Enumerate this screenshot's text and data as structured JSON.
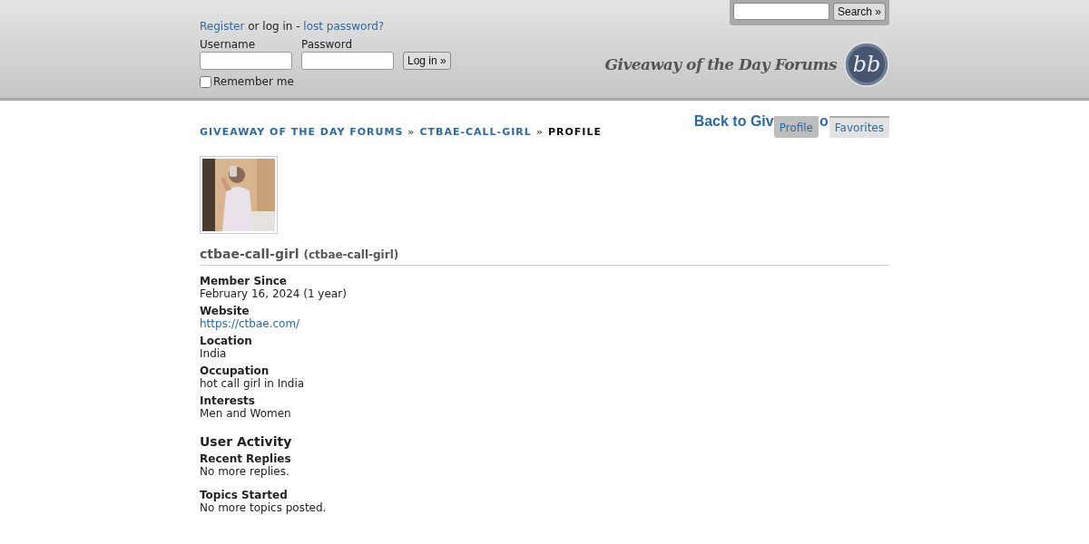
{
  "header": {
    "register_link": "Register",
    "login_text": "or log in -",
    "lost_password_link": "lost password?",
    "username_label": "Username",
    "password_label": "Password",
    "login_button": "Log in »",
    "remember_me": {
      "label": "Remember me",
      "checked": false
    },
    "search_button": "Search »",
    "site_title": "Giveaway of the Day Forums",
    "logo_mark": "bb"
  },
  "back_link": {
    "text": "Back to Giv",
    "fragment": "o"
  },
  "tabs": [
    {
      "label": "Profile",
      "selected": true
    },
    {
      "label": "Favorites",
      "selected": false
    }
  ],
  "breadcrumb": [
    {
      "label": "GIVEAWAY OF THE DAY FORUMS",
      "link": true
    },
    {
      "label": "CTBAE-CALL-GIRL",
      "link": true
    },
    {
      "label": "PROFILE",
      "link": false
    }
  ],
  "breadcrumb_separator": "»",
  "profile": {
    "name": "ctbae-call-girl",
    "username": "(ctbae-call-girl)"
  },
  "fields": [
    {
      "label": "Member Since",
      "value": "February 16, 2024 (1 year)",
      "kind": "text"
    },
    {
      "label": "Website",
      "value": "https://ctbae.com/",
      "kind": "link"
    },
    {
      "label": "Location",
      "value": "India",
      "kind": "text"
    },
    {
      "label": "Occupation",
      "value": "hot call girl in India",
      "kind": "text"
    },
    {
      "label": "Interests",
      "value": "Men and Women",
      "kind": "text"
    }
  ],
  "activity": {
    "title": "User Activity",
    "sections": [
      {
        "label": "Recent Replies",
        "value": "No more replies."
      },
      {
        "label": "Topics Started",
        "value": "No more topics posted."
      }
    ]
  }
}
